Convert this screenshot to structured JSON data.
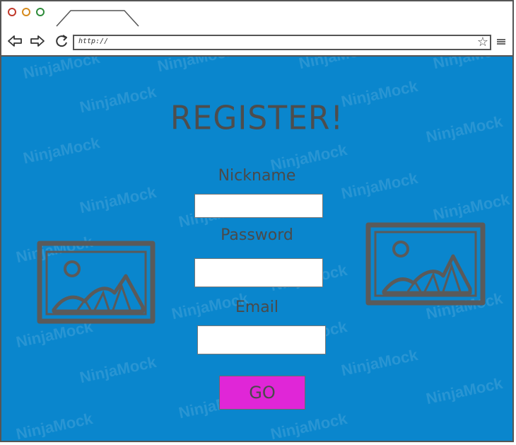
{
  "browser": {
    "url": "http://",
    "icons": {
      "back": "back-arrow-icon",
      "forward": "forward-arrow-icon",
      "reload": "reload-icon",
      "bookmark": "star-icon",
      "menu": "hamburger-menu-icon"
    }
  },
  "watermark": "NinjaMock",
  "page": {
    "title": "REGISTER!",
    "fields": {
      "nickname_label": "Nickname",
      "nickname_value": "",
      "password_label": "Password",
      "password_value": "",
      "email_label": "Email",
      "email_value": ""
    },
    "submit_label": "GO"
  },
  "colors": {
    "background": "#0a86cd",
    "submit_button": "#e026d7",
    "text": "#4a4a4a"
  },
  "images": [
    "image-placeholder-icon",
    "image-placeholder-icon"
  ]
}
